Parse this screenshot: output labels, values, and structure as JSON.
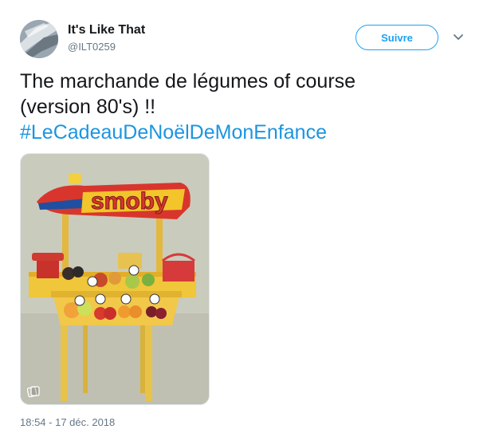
{
  "user": {
    "name": "It's Like That",
    "handle": "@ILT0259"
  },
  "actions": {
    "follow_label": "Suivre"
  },
  "tweet": {
    "line1": "The marchande de légumes of course",
    "line2": "(version 80's) !!",
    "hashtag": "#LeCadeauDeNoëlDeMonEnfance",
    "image_logo_text": "smoby",
    "timestamp": "18:54 - 17 déc. 2018"
  },
  "colors": {
    "accent": "#1da1f2",
    "hashtag": "#1b95e0",
    "secondary_text": "#657786"
  },
  "icons": {
    "more": "chevron-down-icon",
    "media_badge": "gif-icon"
  }
}
